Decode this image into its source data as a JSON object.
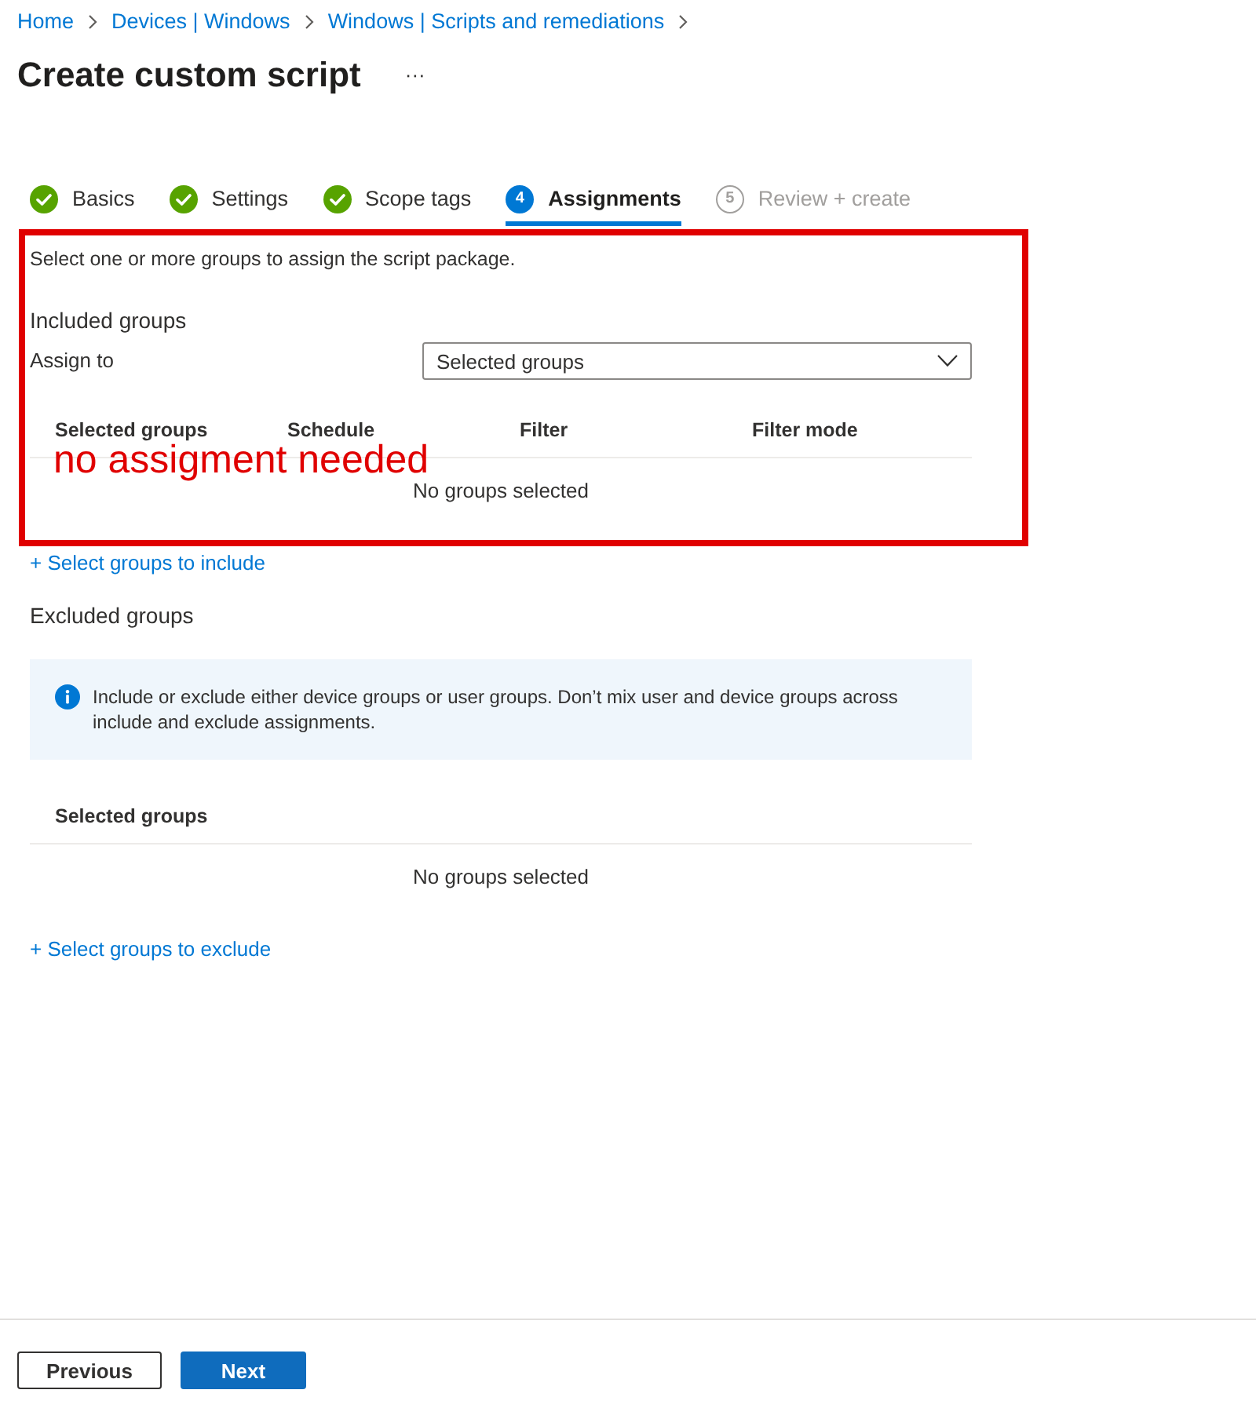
{
  "breadcrumb": [
    {
      "label": "Home"
    },
    {
      "label": "Devices | Windows"
    },
    {
      "label": "Windows | Scripts and remediations"
    }
  ],
  "page_title": "Create custom script",
  "more_button": {
    "label": "···"
  },
  "steps": [
    {
      "label": "Basics",
      "kind": "done",
      "selected": false
    },
    {
      "label": "Settings",
      "kind": "done",
      "selected": false
    },
    {
      "label": "Scope tags",
      "kind": "done",
      "selected": false
    },
    {
      "label": "Assignments",
      "number": "4",
      "kind": "current",
      "selected": true
    },
    {
      "label": "Review + create",
      "number": "5",
      "kind": "upcoming",
      "selected": false
    }
  ],
  "annotation": {
    "text": "no assigment needed"
  },
  "intro": "Select one or more groups to assign the script package.",
  "included": {
    "heading": "Included groups",
    "assign_label": "Assign to",
    "assign_select": {
      "value": "Selected groups"
    },
    "table": {
      "columns": [
        "Selected groups",
        "Schedule",
        "Filter",
        "Filter mode"
      ],
      "empty_text": "No groups selected"
    },
    "add_link": "+ Select groups to include"
  },
  "excluded": {
    "heading": "Excluded groups",
    "info": "Include or exclude either device groups or user groups. Don’t mix user and device groups across include and exclude assignments.",
    "table": {
      "columns": [
        "Selected groups"
      ],
      "empty_text": "No groups selected"
    },
    "add_link": "+ Select groups to exclude"
  },
  "footer": {
    "buttons": [
      {
        "label": "Previous",
        "kind": "secondary"
      },
      {
        "label": "Next",
        "kind": "primary"
      }
    ]
  }
}
